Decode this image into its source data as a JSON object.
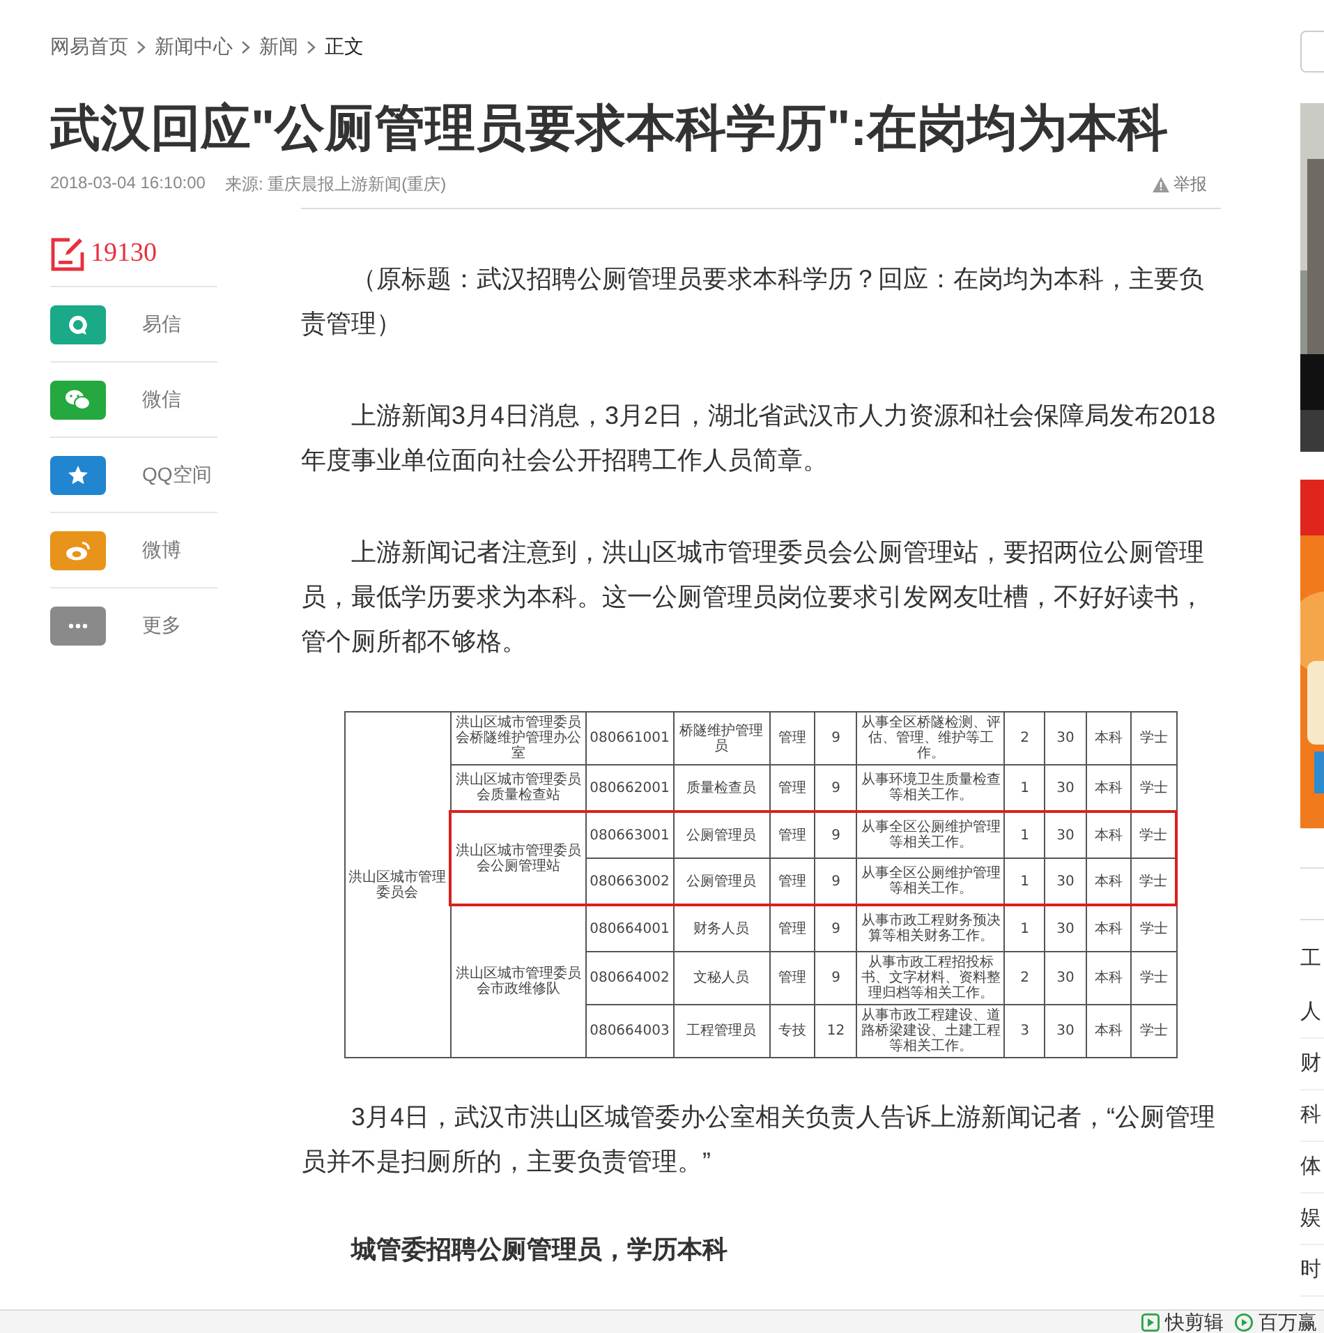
{
  "breadcrumb": [
    {
      "label": "网易首页",
      "current": false
    },
    {
      "label": "新闻中心",
      "current": false
    },
    {
      "label": "新闻",
      "current": false
    },
    {
      "label": "正文",
      "current": true
    }
  ],
  "article": {
    "title": "武汉回应\"公厕管理员要求本科学历\":在岗均为本科",
    "time": "2018-03-04 16:10:00",
    "source": "来源: 重庆晨报上游新闻(重庆)",
    "report": "举报"
  },
  "share": {
    "count": "19130",
    "items": [
      {
        "label": "易信",
        "kind": "yixin",
        "color": "#1aaa87"
      },
      {
        "label": "微信",
        "kind": "wechat",
        "color": "#24a83f"
      },
      {
        "label": "QQ空间",
        "kind": "qzone",
        "color": "#2185cf"
      },
      {
        "label": "微博",
        "kind": "weibo",
        "color": "#e8941a"
      },
      {
        "label": "更多",
        "kind": "more",
        "color": "#8a8a8a"
      }
    ]
  },
  "body": [
    {
      "kind": "paragraph",
      "text": "（原标题：武汉招聘公厕管理员要求本科学历？回应：在岗均为本科，主要负责管理）"
    },
    {
      "kind": "paragraph",
      "text": "上游新闻3月4日消息，3月2日，湖北省武汉市人力资源和社会保障局发布2018年度事业单位面向社会公开招聘工作人员简章。"
    },
    {
      "kind": "paragraph",
      "text": "上游新闻记者注意到，洪山区城市管理委员会公厕管理站，要招两位公厕管理员，最低学历要求为本科。这一公厕管理员岗位要求引发网友吐槽，不好好读书，管个厕所都不够格。"
    },
    {
      "kind": "table",
      "departments": [
        {
          "name": "洪山区城市管理委员会",
          "units": [
            {
              "name": "洪山区城市管理委员会桥隧维护管理办公室",
              "positions": [
                {
                  "code": "080661001",
                  "title": "桥隧维护管理员",
                  "type": "管理",
                  "grade": "9",
                  "duties": "从事全区桥隧检测、评估、管理、维护等工作。",
                  "count": "2",
                  "age": "30",
                  "education": "本科",
                  "degree": "学士",
                  "circled": false
                }
              ]
            },
            {
              "name": "洪山区城市管理委员会质量检查站",
              "positions": [
                {
                  "code": "080662001",
                  "title": "质量检查员",
                  "type": "管理",
                  "grade": "9",
                  "duties": "从事环境卫生质量检查等相关工作。",
                  "count": "1",
                  "age": "30",
                  "education": "本科",
                  "degree": "学士",
                  "circled": false
                }
              ]
            },
            {
              "name": "洪山区城市管理委员会公厕管理站",
              "positions": [
                {
                  "code": "080663001",
                  "title": "公厕管理员",
                  "type": "管理",
                  "grade": "9",
                  "duties": "从事全区公厕维护管理等相关工作。",
                  "count": "1",
                  "age": "30",
                  "education": "本科",
                  "degree": "学士",
                  "circled": true
                },
                {
                  "code": "080663002",
                  "title": "公厕管理员",
                  "type": "管理",
                  "grade": "9",
                  "duties": "从事全区公厕维护管理等相关工作。",
                  "count": "1",
                  "age": "30",
                  "education": "本科",
                  "degree": "学士",
                  "circled": true
                }
              ]
            },
            {
              "name": "洪山区城市管理委员会市政维修队",
              "positions": [
                {
                  "code": "080664001",
                  "title": "财务人员",
                  "type": "管理",
                  "grade": "9",
                  "duties": "从事市政工程财务预决算等相关财务工作。",
                  "count": "1",
                  "age": "30",
                  "education": "本科",
                  "degree": "学士",
                  "circled": false
                },
                {
                  "code": "080664002",
                  "title": "文秘人员",
                  "type": "管理",
                  "grade": "9",
                  "duties": "从事市政工程招投标书、文字材料、资料整理归档等相关工作。",
                  "count": "2",
                  "age": "30",
                  "education": "本科",
                  "degree": "学士",
                  "circled": false
                },
                {
                  "code": "080664003",
                  "title": "工程管理员",
                  "type": "专技",
                  "grade": "12",
                  "duties": "从事市政工程建设、道路桥梁建设、土建工程等相关工作。",
                  "count": "3",
                  "age": "30",
                  "education": "本科",
                  "degree": "学士",
                  "circled": false
                }
              ]
            }
          ]
        }
      ]
    },
    {
      "kind": "paragraph",
      "text": "3月4日，武汉市洪山区城管委办公室相关负责人告诉上游新闻记者，“公厕管理员并不是扫厕所的，主要负责管理。”"
    },
    {
      "kind": "subheading",
      "text": "城管委招聘公厕管理员，学历本科"
    }
  ],
  "right_rail": {
    "heading": "工",
    "items": [
      "人",
      "财",
      "科",
      "体",
      "娱",
      "时"
    ]
  },
  "bottom_bar": [
    {
      "label": "快剪辑",
      "kind": "clip"
    },
    {
      "label": "百万赢",
      "kind": "quiz"
    }
  ]
}
